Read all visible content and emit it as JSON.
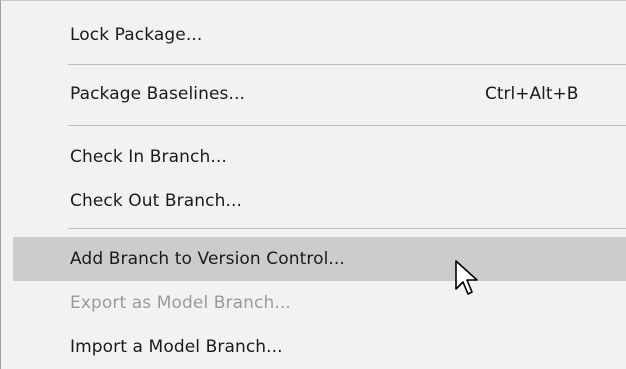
{
  "menu": {
    "items": [
      {
        "label": "Lock Package...",
        "shortcut": ""
      },
      {
        "label": "Package Baselines...",
        "shortcut": "Ctrl+Alt+B"
      },
      {
        "label": "Check In Branch...",
        "shortcut": ""
      },
      {
        "label": "Check Out Branch...",
        "shortcut": ""
      },
      {
        "label": "Add Branch to Version Control...",
        "shortcut": "",
        "state": "highlighted"
      },
      {
        "label": "Export as Model Branch...",
        "shortcut": "",
        "state": "disabled"
      },
      {
        "label": "Import a Model Branch...",
        "shortcut": ""
      }
    ]
  },
  "colors": {
    "menu_background": "#f2f2f2",
    "highlight": "#cccccc",
    "text": "#1a1a1a",
    "disabled_text": "#9a9a9a",
    "separator": "#bdbdbd"
  },
  "cursor": {
    "icon": "arrow-pointer-icon"
  }
}
